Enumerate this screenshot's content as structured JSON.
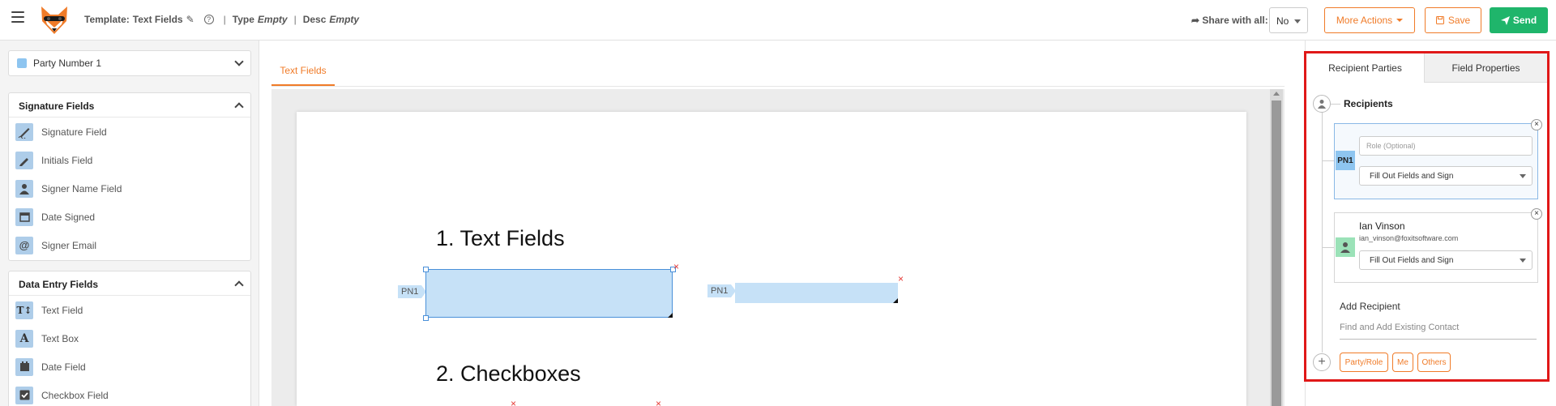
{
  "header": {
    "template_label": "Template:",
    "template_name": "Text Fields",
    "type_label": "Type",
    "type_value": "Empty",
    "desc_label": "Desc",
    "desc_value": "Empty",
    "separator": "|",
    "share_label": "Share with all:",
    "share_value": "No",
    "more_actions_label": "More Actions",
    "save_label": "Save",
    "send_label": "Send"
  },
  "left_panel": {
    "party_select_value": "Party Number 1",
    "signature_section": {
      "title": "Signature Fields",
      "items": [
        {
          "label": "Signature Field",
          "icon": "signature-icon"
        },
        {
          "label": "Initials Field",
          "icon": "pen-icon"
        },
        {
          "label": "Signer Name Field",
          "icon": "person-icon"
        },
        {
          "label": "Date Signed",
          "icon": "calendar-icon"
        },
        {
          "label": "Signer Email",
          "icon": "at-icon"
        }
      ]
    },
    "data_entry_section": {
      "title": "Data Entry Fields",
      "items": [
        {
          "label": "Text Field",
          "icon": "text-field-icon"
        },
        {
          "label": "Text Box",
          "icon": "text-box-icon"
        },
        {
          "label": "Date Field",
          "icon": "calendar-icon"
        },
        {
          "label": "Checkbox Field",
          "icon": "checkbox-icon"
        }
      ]
    }
  },
  "center": {
    "tab_label": "Text Fields",
    "heading_1": "1.  Text Fields",
    "heading_2": "2.  Checkboxes",
    "field_tag": "PN1",
    "delete_mark": "×"
  },
  "right_panel": {
    "tabs": [
      "Recipient Parties",
      "Field Properties"
    ],
    "recipients_title": "Recipients",
    "cards": [
      {
        "badge": "PN1",
        "role_placeholder": "Role (Optional)",
        "action_value": "Fill Out Fields and Sign"
      },
      {
        "name": "Ian Vinson",
        "email": "ian_vinson@foxitsoftware.com",
        "action_value": "Fill Out Fields and Sign"
      }
    ],
    "close_mark": "×",
    "add_recipient_title": "Add Recipient",
    "add_recipient_placeholder": "Find and Add Existing Contact",
    "add_buttons": [
      "Party/Role",
      "Me",
      "Others"
    ]
  },
  "colors": {
    "accent_orange": "#f07b28",
    "send_green": "#1fb56b",
    "party_blue": "#8ec5f0",
    "field_fill": "#c6e1f7",
    "highlight_red": "#e01818"
  }
}
